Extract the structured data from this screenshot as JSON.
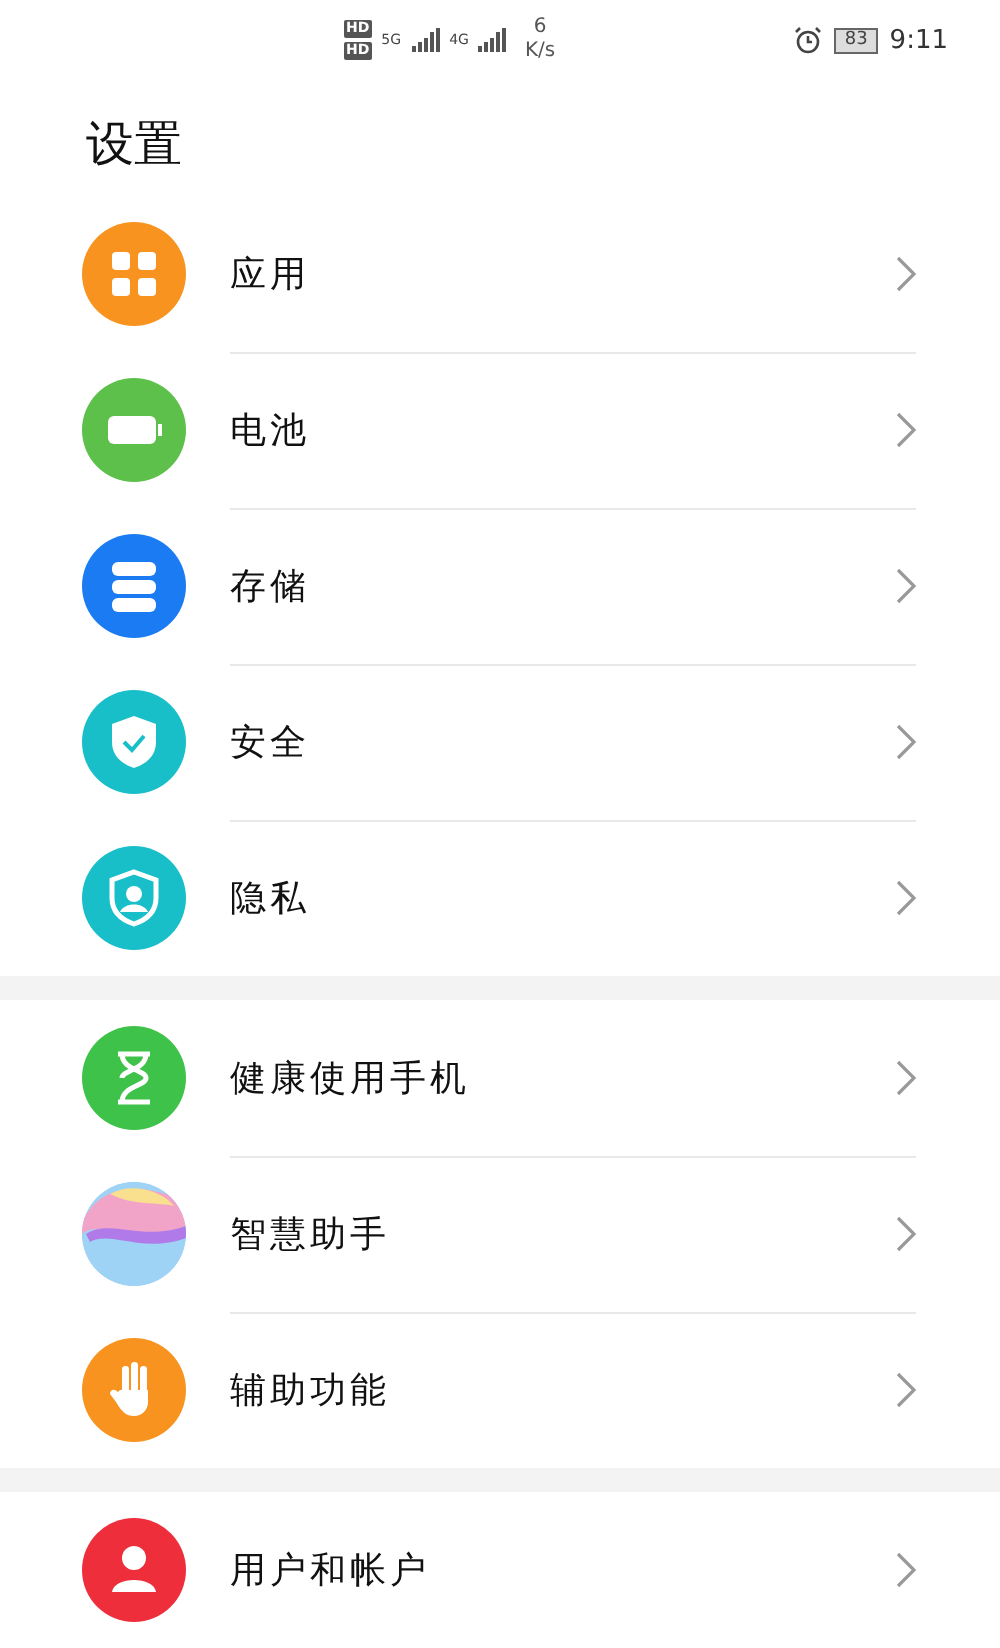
{
  "status_bar": {
    "hd_badges": [
      "HD",
      "HD"
    ],
    "networks": [
      "5G",
      "4G"
    ],
    "speed_value": "6",
    "speed_unit": "K/s",
    "battery": "83",
    "time": "9:11"
  },
  "title": "设置",
  "groups": [
    {
      "items": [
        {
          "label": "应用",
          "kind": "apps",
          "color": "#f7931e"
        },
        {
          "label": "电池",
          "kind": "battery",
          "color": "#5cc04a"
        },
        {
          "label": "存储",
          "kind": "storage",
          "color": "#1a7bf2"
        },
        {
          "label": "安全",
          "kind": "security",
          "color": "#19bfc8"
        },
        {
          "label": "隐私",
          "kind": "privacy",
          "color": "#19bfc8"
        }
      ]
    },
    {
      "items": [
        {
          "label": "健康使用手机",
          "kind": "hourglass",
          "color": "#3fc24a"
        },
        {
          "label": "智慧助手",
          "kind": "assistant"
        },
        {
          "label": "辅助功能",
          "kind": "hand",
          "color": "#f7931e"
        }
      ]
    },
    {
      "items": [
        {
          "label": "用户和帐户",
          "kind": "user",
          "color": "#ee2e3a"
        }
      ]
    }
  ]
}
